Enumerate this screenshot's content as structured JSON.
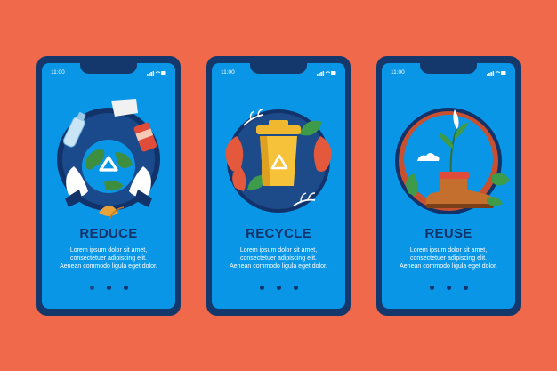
{
  "screens": [
    {
      "status_time": "11:00",
      "title": "REDUCE",
      "body": [
        "Lorem ipsum dolor sit amet,",
        "consectetuer adipiscing elit.",
        "Aenean commodo ligula eget dolor."
      ],
      "illustration": "globe-recycle-icon"
    },
    {
      "status_time": "11:00",
      "title": "RECYCLE",
      "body": [
        "Lorem ipsum dolor sit amet,",
        "consectetuer adipiscing elit.",
        "Aenean commodo ligula eget dolor."
      ],
      "illustration": "recycle-bin-icon"
    },
    {
      "status_time": "11:00",
      "title": "REUSE",
      "body": [
        "Lorem ipsum dolor sit amet,",
        "consectetuer adipiscing elit.",
        "Aenean commodo ligula eget dolor."
      ],
      "illustration": "boot-plant-icon"
    }
  ],
  "colors": {
    "background": "#f0694a",
    "phone_frame": "#15386c",
    "screen": "#0a96e6",
    "title": "#12326a"
  }
}
